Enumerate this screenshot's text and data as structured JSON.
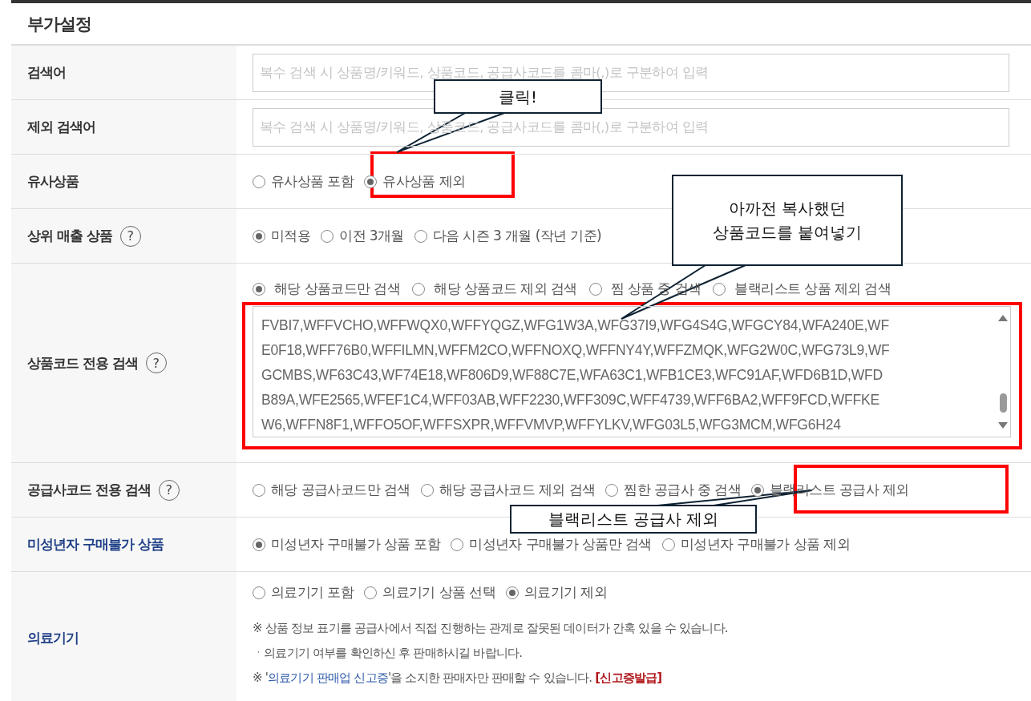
{
  "section_title": "부가설정",
  "rows": [
    {
      "kind": "input",
      "label": "검색어",
      "accent": false,
      "placeholder": "복수 검색 시 상품명/키워드, 상품코드, 공급사코드를 콤마(,)로 구분하여 입력"
    },
    {
      "kind": "input",
      "label": "제외 검색어",
      "accent": false,
      "placeholder": "복수 검색 시 상품명/키워드, 상품코드, 공급사코드를 콤마(,)로 구분하여 입력"
    },
    {
      "kind": "radios",
      "label": "유사상품",
      "accent": false,
      "options": [
        {
          "label": "유사상품 포함",
          "selected": false
        },
        {
          "label": "유사상품 제외",
          "selected": true
        }
      ]
    },
    {
      "kind": "radios",
      "label": "상위 매출 상품",
      "help": "?",
      "accent": false,
      "options": [
        {
          "label": "미적용",
          "selected": true
        },
        {
          "label": "이전 3개월",
          "selected": false
        },
        {
          "label": "다음 시즌 3 개월 (작년 기준)",
          "selected": false
        }
      ]
    },
    {
      "kind": "codes",
      "label": "상품코드 전용 검색",
      "help": "?",
      "accent": false,
      "options": [
        {
          "label": "해당 상품코드만 검색",
          "selected": true
        },
        {
          "label": "해당 상품코드 제외 검색",
          "selected": false
        },
        {
          "label": "찜 상품 중 검색",
          "selected": false
        },
        {
          "label": "블랙리스트 상품 제외 검색",
          "selected": false
        }
      ],
      "value_lines": [
        "FVBI7,WFFVCHO,WFFWQX0,WFFYQGZ,WFG1W3A,WFG37I9,WFG4S4G,WFGCY84,WFA240E,WF",
        "E0F18,WFF76B0,WFFILMN,WFFM2CO,WFFNOXQ,WFFNY4Y,WFFZMQK,WFG2W0C,WFG73L9,WF",
        "GCMBS,WF63C43,WF74E18,WF806D9,WF88C7E,WFA63C1,WFB1CE3,WFC91AF,WFD6B1D,WFD",
        "B89A,WFE2565,WFEF1C4,WFF03AB,WFF2230,WFF309C,WFF4739,WFF6BA2,WFF9FCD,WFFKE",
        "W6,WFFN8F1,WFFO5OF,WFFSXPR,WFFVMVP,WFFYLKV,WFG03L5,WFG3MCM,WFG6H24"
      ]
    },
    {
      "kind": "radios",
      "label": "공급사코드 전용 검색",
      "help": "?",
      "accent": false,
      "options": [
        {
          "label": "해당 공급사코드만 검색",
          "selected": false
        },
        {
          "label": "해당 공급사코드 제외 검색",
          "selected": false
        },
        {
          "label": "찜한 공급사 중 검색",
          "selected": false
        },
        {
          "label": "블랙리스트 공급사 제외",
          "selected": true
        }
      ]
    },
    {
      "kind": "radios",
      "label": "미성년자 구매불가 상품",
      "accent": true,
      "options": [
        {
          "label": "미성년자 구매불가 상품 포함",
          "selected": true
        },
        {
          "label": "미성년자 구매불가 상품만 검색",
          "selected": false
        },
        {
          "label": "미성년자 구매불가 상품 제외",
          "selected": false
        }
      ]
    },
    {
      "kind": "notes",
      "label": "의료기기",
      "accent": true,
      "options": [
        {
          "label": "의료기기 포함",
          "selected": false
        },
        {
          "label": "의료기기 상품 선택",
          "selected": false
        },
        {
          "label": "의료기기 제외",
          "selected": true
        }
      ],
      "notes": [
        {
          "parts": [
            {
              "text": "※ 상품 정보 표기를 공급사에서 직접 진행하는 관계로 잘못된 데이터가 간혹 있을 수 있습니다."
            }
          ]
        },
        {
          "parts": [
            {
              "text": "ㆍ의료기기 여부를 확인하신 후 판매하시길 바랍니다."
            }
          ]
        },
        {
          "parts": [
            {
              "text": "※ '"
            },
            {
              "text": "의료기기 판매업 신고증",
              "kind": "link"
            },
            {
              "text": "'을 소지한 판매자만 판매할 수 있습니다. "
            },
            {
              "text": "[신고증발급]",
              "kind": "action"
            }
          ]
        }
      ]
    }
  ],
  "annotations": [
    {
      "kind": "highlight"
    },
    {
      "kind": "highlight"
    },
    {
      "kind": "highlight"
    },
    {
      "kind": "callout",
      "lines": [
        "클릭!"
      ]
    },
    {
      "kind": "callout",
      "lines": [
        "아까전 복사했던",
        "상품코드를 붙여넣기"
      ]
    },
    {
      "kind": "callout",
      "lines": [
        "블랙리스트 공급사 제외"
      ]
    }
  ]
}
